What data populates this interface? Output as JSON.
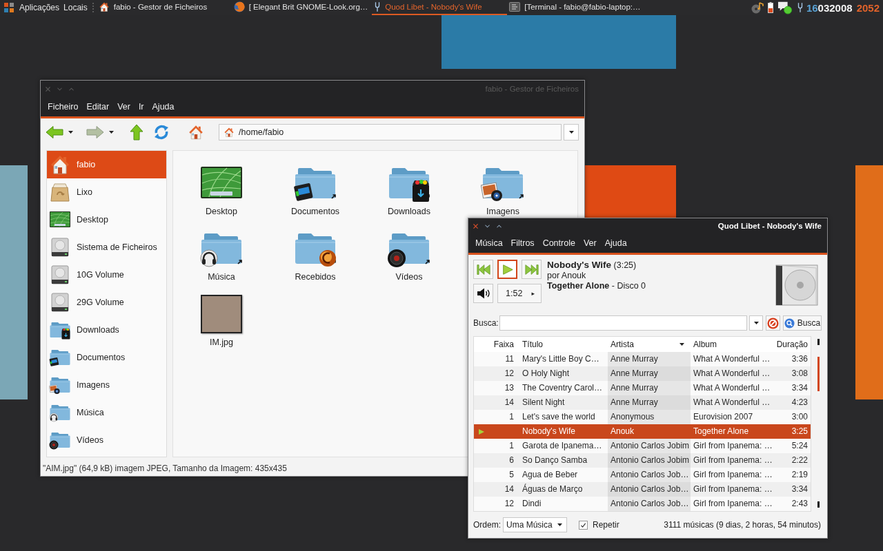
{
  "panel": {
    "menus": [
      "Aplicações",
      "Locais"
    ],
    "tasks": [
      {
        "kind": "files",
        "label": "fabio - Gestor de Ficheiros",
        "selected": false
      },
      {
        "kind": "browser",
        "label": "[ Elegant Brit GNOME-Look.org…",
        "selected": false
      },
      {
        "kind": "player",
        "label": "Quod Libet - Nobody's Wife",
        "selected": true
      },
      {
        "kind": "terminal",
        "label": "[Terminal - fabio@fabio-laptop:…",
        "selected": false
      }
    ],
    "clock": {
      "day": "16",
      "month_year": "032008",
      "time": "2052"
    }
  },
  "file_manager": {
    "window": {
      "title": "fabio - Gestor de Ficheiros",
      "active": false
    },
    "menu": [
      "Ficheiro",
      "Editar",
      "Ver",
      "Ir",
      "Ajuda"
    ],
    "toolbar": [
      {
        "kind": "back",
        "disabled": false,
        "dropdown": true
      },
      {
        "kind": "forward",
        "disabled": true,
        "dropdown": true
      },
      {
        "kind": "up",
        "disabled": false,
        "dropdown": false
      },
      {
        "kind": "reload",
        "disabled": false,
        "dropdown": false
      },
      {
        "kind": "home",
        "disabled": false,
        "dropdown": false
      }
    ],
    "location": {
      "value": "/home/fabio"
    },
    "sidebar": {
      "items": [
        {
          "kind": "home",
          "label": "fabio",
          "selected": true
        },
        {
          "kind": "trash",
          "label": "Lixo",
          "selected": false
        },
        {
          "kind": "desktop",
          "label": "Desktop",
          "selected": false
        },
        {
          "kind": "drive",
          "label": "Sistema de Ficheiros",
          "selected": false
        },
        {
          "kind": "drive",
          "label": "10G Volume",
          "selected": false
        },
        {
          "kind": "drive",
          "label": "29G Volume",
          "selected": false
        },
        {
          "kind": "downloads",
          "label": "Downloads",
          "selected": false
        },
        {
          "kind": "documents",
          "label": "Documentos",
          "selected": false
        },
        {
          "kind": "pictures",
          "label": "Imagens",
          "selected": false
        },
        {
          "kind": "music",
          "label": "Música",
          "selected": false
        },
        {
          "kind": "videos",
          "label": "Vídeos",
          "selected": false
        }
      ]
    },
    "files": [
      {
        "kind": "desktop",
        "label": "Desktop"
      },
      {
        "kind": "documents",
        "label": "Documentos"
      },
      {
        "kind": "downloads",
        "label": "Downloads"
      },
      {
        "kind": "pictures",
        "label": "Imagens"
      },
      {
        "kind": "music",
        "label": "Música"
      },
      {
        "kind": "received",
        "label": "Recebidos"
      },
      {
        "kind": "videos",
        "label": "Vídeos"
      },
      {
        "kind": "photo",
        "label": "IM.jpg"
      }
    ],
    "status_bar": "\"AIM.jpg\" (64,9 kB) imagem JPEG, Tamanho da Imagem: 435x435"
  },
  "player": {
    "window": {
      "title": "Quod Libet - Nobody's Wife",
      "active": true
    },
    "menu": [
      "Música",
      "Filtros",
      "Controle",
      "Ver",
      "Ajuda"
    ],
    "transport": [
      {
        "kind": "previous",
        "focused": false
      },
      {
        "kind": "play",
        "focused": true
      },
      {
        "kind": "next",
        "focused": false
      }
    ],
    "position": {
      "time": "1:52",
      "arrow": "▸"
    },
    "song": {
      "title_line": "**Nobody's Wife** (3:25)",
      "artist_line": "por Anouk",
      "album_line": "**Together Alone** - Disco 0"
    },
    "search": {
      "label": "Busca:",
      "button": "Busca"
    },
    "table": {
      "columns": [
        {
          "label": "Faixa",
          "kind": "number",
          "sorted": false
        },
        {
          "label": "Título",
          "kind": "text",
          "sorted": false
        },
        {
          "label": "Artista",
          "kind": "text",
          "sorted": true
        },
        {
          "label": "Album",
          "kind": "text",
          "sorted": false
        },
        {
          "label": "Duração",
          "kind": "number",
          "sorted": false
        }
      ],
      "rows": [
        {
          "track": "11",
          "title": "Mary's Little Boy C…",
          "artist": "Anne Murray",
          "album": "What A Wonderful …",
          "length": "3:36",
          "selected": false,
          "playing": false
        },
        {
          "track": "12",
          "title": "O Holy Night",
          "artist": "Anne Murray",
          "album": "What A Wonderful …",
          "length": "3:08",
          "selected": false,
          "playing": false
        },
        {
          "track": "13",
          "title": "The Coventry Carol…",
          "artist": "Anne Murray",
          "album": "What A Wonderful …",
          "length": "3:34",
          "selected": false,
          "playing": false
        },
        {
          "track": "14",
          "title": "Silent Night",
          "artist": "Anne Murray",
          "album": "What A Wonderful …",
          "length": "4:23",
          "selected": false,
          "playing": false
        },
        {
          "track": "1",
          "title": "Let's save the world",
          "artist": "Anonymous",
          "album": "Eurovision 2007",
          "length": "3:00",
          "selected": false,
          "playing": false
        },
        {
          "title": "Nobody's Wife",
          "artist": "Anouk",
          "album": "Together Alone",
          "length": "3:25",
          "selected": true,
          "playing": true
        },
        {
          "track": "1",
          "title": "Garota de Ipanema…",
          "artist": "Antonio Carlos Jobim",
          "album": "Girl from Ipanema: …",
          "length": "5:24",
          "selected": false,
          "playing": false
        },
        {
          "track": "6",
          "title": "So Danço Samba",
          "artist": "Antonio Carlos Jobim",
          "album": "Girl from Ipanema: …",
          "length": "2:22",
          "selected": false,
          "playing": false
        },
        {
          "track": "5",
          "title": "Agua de Beber",
          "artist": "Antonio Carlos Job…",
          "album": "Girl from Ipanema: …",
          "length": "2:19",
          "selected": false,
          "playing": false
        },
        {
          "track": "14",
          "title": "Águas de Março",
          "artist": "Antonio Carlos Job…",
          "album": "Girl from Ipanema: …",
          "length": "3:34",
          "selected": false,
          "playing": false
        },
        {
          "track": "12",
          "title": "Dindi",
          "artist": "Antonio Carlos Job…",
          "album": "Girl from Ipanema: …",
          "length": "2:43",
          "selected": false,
          "playing": false
        }
      ]
    },
    "order": {
      "label": "Ordem:",
      "value": "Uma Música"
    },
    "repeat": {
      "label": "Repetir",
      "checked": true
    },
    "summary": "3111 músicas (9 dias, 2 horas, 54 minutos)"
  }
}
